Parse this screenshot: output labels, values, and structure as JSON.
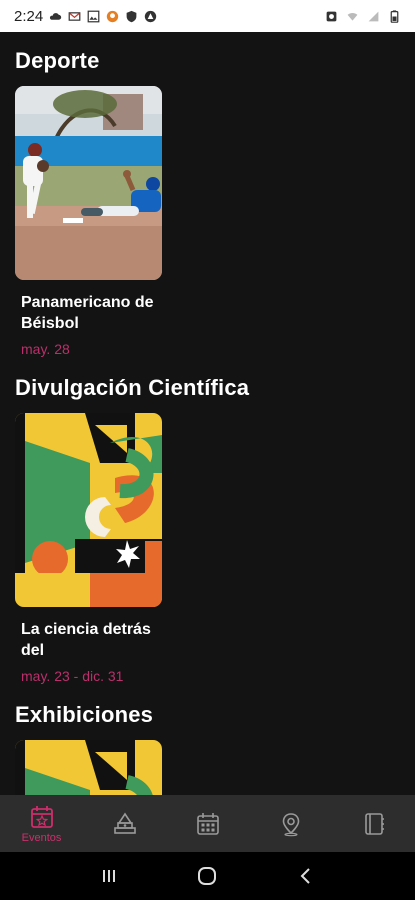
{
  "status_bar": {
    "time": "2:24"
  },
  "sections": [
    {
      "title": "Deporte",
      "card": {
        "title": "Panamericano de Béisbol",
        "date": "may. 28"
      }
    },
    {
      "title": "Divulgación Científica",
      "card": {
        "title": "La ciencia detrás del",
        "date": "may. 23 - dic. 31"
      }
    },
    {
      "title": "Exhibiciones"
    }
  ],
  "bottom_nav": {
    "items": [
      {
        "label": "Eventos",
        "icon": "calendar-star-icon",
        "active": true
      },
      {
        "icon": "monument-icon"
      },
      {
        "icon": "calendar-grid-icon"
      },
      {
        "icon": "map-pin-icon"
      },
      {
        "icon": "notebook-icon"
      }
    ]
  },
  "colors": {
    "background": "#131313",
    "accent": "#cc2f6b",
    "date": "#b9306a",
    "nav_background": "#2d2d2d"
  }
}
